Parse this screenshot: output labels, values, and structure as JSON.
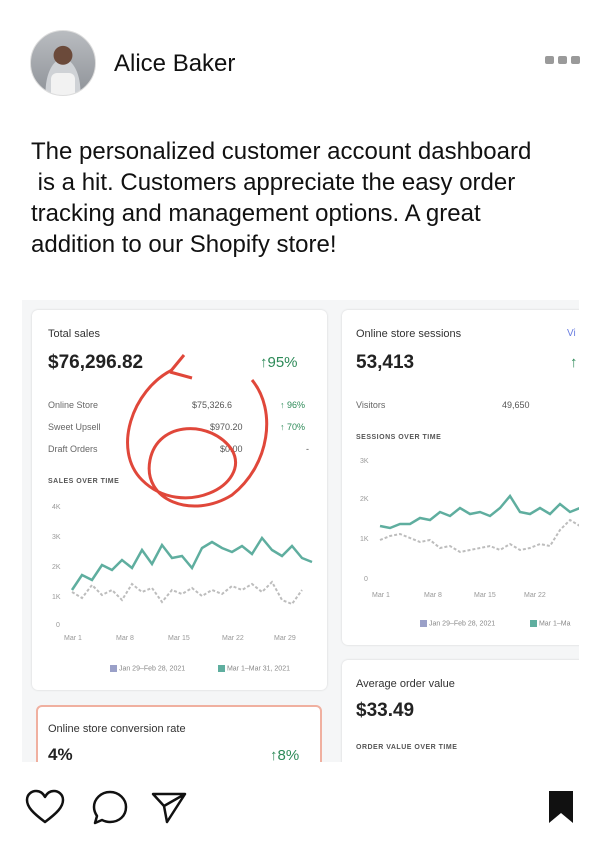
{
  "post": {
    "username": "Alice Baker",
    "caption": "The personalized customer account dashboard\n is a hit. Customers appreciate the easy order\ntracking and management options. A great\naddition to our Shopify store!"
  },
  "dashboard": {
    "sales": {
      "title": "Total sales",
      "value": "$76,296.82",
      "change": "↑95%",
      "rows": [
        {
          "label": "Online Store",
          "value": "$75,326.6",
          "change": "↑ 96%"
        },
        {
          "label": "Sweet Upsell",
          "value": "$970.20",
          "change": "↑ 70%"
        },
        {
          "label": "Draft Orders",
          "value": "$0.00",
          "change": "-"
        }
      ],
      "chart_title": "SALES OVER TIME",
      "yticks": [
        "4K",
        "3K",
        "2K",
        "1K",
        "0"
      ],
      "xticks": [
        "Mar 1",
        "Mar 8",
        "Mar 15",
        "Mar 22",
        "Mar 29"
      ],
      "legend": [
        "Jan 29–Feb 28, 2021",
        "Mar 1–Mar 31, 2021"
      ]
    },
    "sessions": {
      "title": "Online store sessions",
      "link": "Vi",
      "value": "53,413",
      "change": "↑",
      "row_label": "Visitors",
      "row_value": "49,650",
      "chart_title": "SESSIONS OVER TIME",
      "yticks": [
        "3K",
        "2K",
        "1K",
        "0"
      ],
      "xticks": [
        "Mar 1",
        "Mar 8",
        "Mar 15",
        "Mar 22"
      ],
      "legend": [
        "Jan 29–Feb 28, 2021",
        "Mar 1–Ma"
      ]
    },
    "conversion": {
      "title": "Online store conversion rate",
      "value": "4%",
      "change": "↑8%"
    },
    "aov": {
      "title": "Average order value",
      "value": "$33.49",
      "chart_title": "ORDER VALUE OVER TIME"
    },
    "colors": {
      "teal": "#5fae9f",
      "gray": "#bdbdbd",
      "green": "#2d8a58",
      "annotation": "#e0473a"
    }
  },
  "icons": [
    "heart-icon",
    "comment-icon",
    "share-icon",
    "bookmark-icon",
    "more-icon"
  ]
}
